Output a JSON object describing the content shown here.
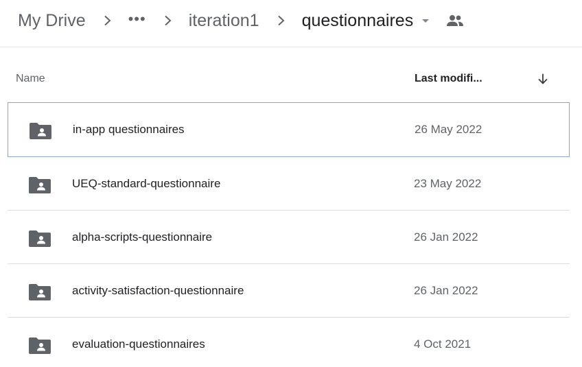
{
  "breadcrumb": {
    "root": "My Drive",
    "ellipsis": "•••",
    "parent": "iteration1",
    "current": "questionnaires"
  },
  "icons": {
    "separator": "chevron-right-icon",
    "caret": "caret-down-icon",
    "shared": "people-icon",
    "sort": "arrow-down-icon",
    "folder": "shared-folder-icon"
  },
  "columns": {
    "name": "Name",
    "last_modified": "Last modifi..."
  },
  "files": [
    {
      "name": "in-app questionnaires",
      "modified": "26 May 2022",
      "selected": true
    },
    {
      "name": "UEQ-standard-questionnaire",
      "modified": "23 May 2022",
      "selected": false
    },
    {
      "name": "alpha-scripts-questionnaire",
      "modified": "26 Jan 2022",
      "selected": false
    },
    {
      "name": "activity-satisfaction-questionnaire",
      "modified": "26 Jan 2022",
      "selected": false
    },
    {
      "name": "evaluation-questionnaires",
      "modified": "4 Oct 2021",
      "selected": false
    }
  ],
  "colors": {
    "selected_border": "#8ea4cf",
    "folder": "#5f6368",
    "divider": "#dadce0"
  }
}
